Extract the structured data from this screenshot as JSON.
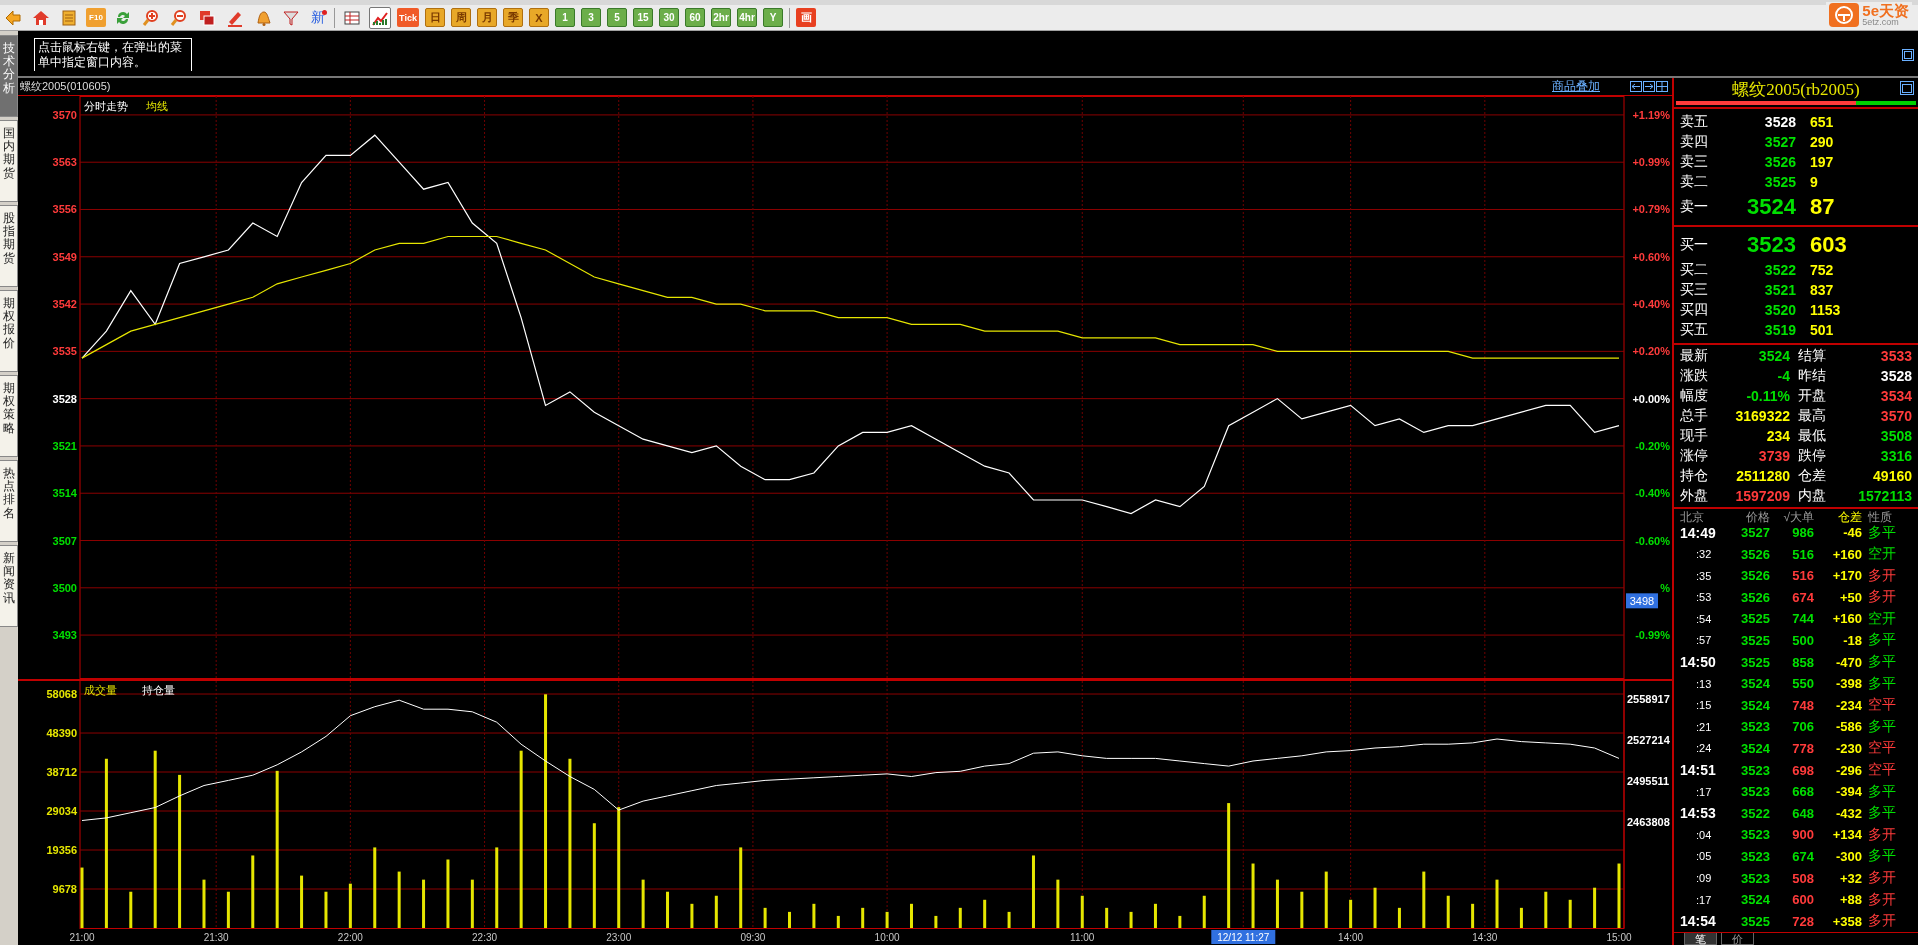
{
  "toolbar": {
    "groups": [
      [
        {
          "kind": "back",
          "selected": false
        },
        {
          "kind": "home",
          "selected": false
        },
        {
          "kind": "note",
          "selected": false
        },
        {
          "kind": "f10",
          "label": "F10",
          "selected": false
        },
        {
          "kind": "refresh",
          "selected": false
        },
        {
          "kind": "zoom_in",
          "selected": false
        },
        {
          "kind": "zoom_out",
          "selected": false
        },
        {
          "kind": "windows",
          "selected": false
        },
        {
          "kind": "pencil",
          "selected": false
        },
        {
          "kind": "bell",
          "selected": false
        },
        {
          "kind": "filter",
          "selected": false
        },
        {
          "kind": "new",
          "label": "新",
          "selected": false
        }
      ],
      [
        {
          "kind": "table",
          "selected": false
        },
        {
          "kind": "chart",
          "selected": true
        },
        {
          "kind": "tick",
          "label": "Tick",
          "selected": false
        },
        {
          "kind": "period",
          "label": "日",
          "selected": false
        },
        {
          "kind": "period",
          "label": "周",
          "selected": false
        },
        {
          "kind": "period",
          "label": "月",
          "selected": false
        },
        {
          "kind": "period",
          "label": "季",
          "selected": false
        },
        {
          "kind": "period",
          "label": "X",
          "selected": false
        },
        {
          "kind": "minute",
          "label": "1",
          "selected": false
        },
        {
          "kind": "minute",
          "label": "3",
          "selected": false
        },
        {
          "kind": "minute",
          "label": "5",
          "selected": false
        },
        {
          "kind": "minute",
          "label": "15",
          "selected": false
        },
        {
          "kind": "minute",
          "label": "30",
          "selected": false
        },
        {
          "kind": "minute",
          "label": "60",
          "selected": false
        },
        {
          "kind": "minute",
          "label": "2hr",
          "selected": false
        },
        {
          "kind": "minute",
          "label": "4hr",
          "selected": false
        },
        {
          "kind": "minute",
          "label": "Y",
          "selected": false
        }
      ],
      [
        {
          "kind": "draw",
          "label": "画",
          "selected": false
        }
      ]
    ]
  },
  "logo": {
    "name": "5e天资",
    "domain": "5etz.com"
  },
  "side_tabs": [
    {
      "label": "技术分析",
      "selected": true
    },
    {
      "label": "国内期货",
      "selected": false
    },
    {
      "label": "股指期货",
      "selected": false
    },
    {
      "label": "期权报价",
      "selected": false
    },
    {
      "label": "期权策略",
      "selected": false
    },
    {
      "label": "热点排名",
      "selected": false
    },
    {
      "label": "新闻资讯",
      "selected": false
    }
  ],
  "hint": "点击鼠标右键，在弹出的菜单中指定窗口内容。",
  "chart_header": {
    "title": "螺纹2005(010605)",
    "overlay_link": "商品叠加"
  },
  "price_chart": {
    "chart_data": {
      "type": "line",
      "grid": true,
      "series": [
        {
          "name": "分时走势",
          "color": "#ffffff",
          "values": [
            3534,
            3538,
            3544,
            3539,
            3548,
            3549,
            3550,
            3554,
            3552,
            3560,
            3564,
            3564,
            3567,
            3563,
            3559,
            3560,
            3554,
            3551,
            3540,
            3527,
            3529,
            3526,
            3524,
            3522,
            3521,
            3520,
            3521,
            3518,
            3516,
            3516,
            3517,
            3521,
            3523,
            3523,
            3524,
            3522,
            3520,
            3518,
            3517,
            3513,
            3513,
            3513,
            3512,
            3511,
            3513,
            3512,
            3515,
            3524,
            3526,
            3528,
            3525,
            3526,
            3527,
            3524,
            3525,
            3523,
            3524,
            3524,
            3525,
            3526,
            3527,
            3527,
            3523,
            3524
          ]
        },
        {
          "name": "均线",
          "color": "#e6e600",
          "values": [
            3534,
            3536,
            3538,
            3539,
            3540,
            3541,
            3542,
            3543,
            3545,
            3546,
            3547,
            3548,
            3550,
            3551,
            3551,
            3552,
            3552,
            3552,
            3551,
            3550,
            3548,
            3546,
            3545,
            3544,
            3543,
            3543,
            3542,
            3542,
            3541,
            3541,
            3541,
            3540,
            3540,
            3540,
            3539,
            3539,
            3539,
            3538,
            3538,
            3538,
            3538,
            3537,
            3537,
            3537,
            3537,
            3536,
            3536,
            3536,
            3536,
            3535,
            3535,
            3535,
            3535,
            3535,
            3535,
            3535,
            3535,
            3534,
            3534,
            3534,
            3534,
            3534,
            3534,
            3534
          ]
        }
      ],
      "ylim": [
        3486.5,
        3572.8
      ],
      "yticks": [
        3570,
        3563,
        3556,
        3549,
        3542,
        3535,
        3528,
        3521,
        3514,
        3507,
        3500,
        3493
      ]
    },
    "percent_labels": [
      {
        "label": "+1.19%",
        "color": "#ff3b3b"
      },
      {
        "label": "+0.99%",
        "color": "#ff3b3b"
      },
      {
        "label": "+0.79%",
        "color": "#ff3b3b"
      },
      {
        "label": "+0.60%",
        "color": "#ff3b3b"
      },
      {
        "label": "+0.40%",
        "color": "#ff3b3b"
      },
      {
        "label": "+0.20%",
        "color": "#ff3b3b"
      },
      {
        "label": "+0.00%",
        "color": "#ffffff"
      },
      {
        "label": "-0.20%",
        "color": "#00e000"
      },
      {
        "label": "-0.40%",
        "color": "#00e000"
      },
      {
        "label": "-0.60%",
        "color": "#00e000"
      },
      {
        "label": "%",
        "color": "#00e000"
      },
      {
        "label": "-0.99%",
        "color": "#00e000"
      }
    ],
    "cursor_price": "3498"
  },
  "volume_chart": {
    "chart_data": {
      "type": "bar",
      "grid": true,
      "series": [
        {
          "name": "成交量",
          "color": "#e6e600",
          "values": [
            15000,
            42000,
            9000,
            44000,
            38000,
            12000,
            9000,
            18000,
            39000,
            13000,
            9000,
            11000,
            20000,
            14000,
            12000,
            17000,
            12000,
            20000,
            44000,
            58000,
            42000,
            26000,
            30000,
            12000,
            9000,
            6000,
            8000,
            20000,
            5000,
            4000,
            6000,
            3000,
            5000,
            4000,
            6000,
            3000,
            5000,
            7000,
            4000,
            18000,
            12000,
            8000,
            5000,
            4000,
            6000,
            3000,
            8000,
            31000,
            16000,
            12000,
            9000,
            14000,
            7000,
            10000,
            5000,
            14000,
            8000,
            6000,
            12000,
            5000,
            9000,
            7000,
            10000,
            16000
          ]
        }
      ],
      "ylim": [
        0,
        61300
      ],
      "yticks": [
        58068,
        48390,
        38712,
        29034,
        19356,
        9678
      ]
    }
  },
  "open_interest_chart": {
    "chart_data": {
      "type": "line",
      "series": [
        {
          "name": "持仓量",
          "color": "#ffffff",
          "values": [
            2465000,
            2467000,
            2471000,
            2475000,
            2484000,
            2492000,
            2496000,
            2500000,
            2508000,
            2518000,
            2530000,
            2546000,
            2553000,
            2558000,
            2551000,
            2551000,
            2549000,
            2541000,
            2524000,
            2511000,
            2499000,
            2489000,
            2473000,
            2480000,
            2484000,
            2488000,
            2492000,
            2494000,
            2496000,
            2497000,
            2498000,
            2499000,
            2500000,
            2501000,
            2499000,
            2502000,
            2503000,
            2507000,
            2509000,
            2517000,
            2518000,
            2515000,
            2513000,
            2513000,
            2513000,
            2511000,
            2509000,
            2507000,
            2511000,
            2513000,
            2515000,
            2518000,
            2519000,
            2521000,
            2522000,
            2524000,
            2524000,
            2525000,
            2528000,
            2526000,
            2525000,
            2524000,
            2521000,
            2513000
          ]
        }
      ],
      "ylim": [
        2381845,
        2572835
      ],
      "yticks": [
        2558917,
        2527214,
        2495511,
        2463808
      ]
    }
  },
  "time_axis": {
    "labels": [
      "21:00",
      "21:30",
      "22:00",
      "22:30",
      "23:00",
      "09:30",
      "10:00",
      "11:00",
      "14:00",
      "14:30",
      "15:00"
    ],
    "cursor_time": "12/12 11:27"
  },
  "quote": {
    "title": "螺纹2005(rb2005)",
    "level": 0.75,
    "sells": [
      {
        "label": "卖五",
        "price": "3528",
        "volume": "651"
      },
      {
        "label": "卖四",
        "price": "3527",
        "volume": "290"
      },
      {
        "label": "卖三",
        "price": "3526",
        "volume": "197"
      },
      {
        "label": "卖二",
        "price": "3525",
        "volume": "9"
      },
      {
        "label": "卖一",
        "price": "3524",
        "volume": "87"
      }
    ],
    "buys": [
      {
        "label": "买一",
        "price": "3523",
        "volume": "603"
      },
      {
        "label": "买二",
        "price": "3522",
        "volume": "752"
      },
      {
        "label": "买三",
        "price": "3521",
        "volume": "837"
      },
      {
        "label": "买四",
        "price": "3520",
        "volume": "1153"
      },
      {
        "label": "买五",
        "price": "3519",
        "volume": "501"
      }
    ],
    "stats": [
      {
        "label": "最新",
        "value": "3524",
        "color": "#00e000"
      },
      {
        "label": "结算",
        "value": "3533",
        "color": "#ff3b3b"
      },
      {
        "label": "涨跌",
        "value": "-4",
        "color": "#00e000"
      },
      {
        "label": "昨结",
        "value": "3528",
        "color": "#ffffff"
      },
      {
        "label": "幅度",
        "value": "-0.11%",
        "color": "#00e000"
      },
      {
        "label": "开盘",
        "value": "3534",
        "color": "#ff3b3b"
      },
      {
        "label": "总手",
        "value": "3169322",
        "color": "#ffff00"
      },
      {
        "label": "最高",
        "value": "3570",
        "color": "#ff3b3b"
      },
      {
        "label": "现手",
        "value": "234",
        "color": "#ffff00"
      },
      {
        "label": "最低",
        "value": "3508",
        "color": "#00e000"
      },
      {
        "label": "涨停",
        "value": "3739",
        "color": "#ff3b3b"
      },
      {
        "label": "跌停",
        "value": "3316",
        "color": "#00e000"
      },
      {
        "label": "持仓",
        "value": "2511280",
        "color": "#ffff00"
      },
      {
        "label": "仓差",
        "value": "49160",
        "color": "#ffff00"
      },
      {
        "label": "外盘",
        "value": "1597209",
        "color": "#ff3b3b"
      },
      {
        "label": "内盘",
        "value": "1572113",
        "color": "#00e000"
      }
    ]
  },
  "ticks": {
    "columns": [
      "北京",
      "价格",
      "√大单",
      "仓差",
      "性质"
    ],
    "rows": [
      {
        "kind": "minute",
        "time": "14:49",
        "price": "3527",
        "volume": "986",
        "oi_change": "-46",
        "nature": "多平",
        "color": "#00e000"
      },
      {
        "kind": "second",
        "time": ":32",
        "price": "3526",
        "volume": "516",
        "oi_change": "+160",
        "nature": "空开",
        "color": "#00e000"
      },
      {
        "kind": "second",
        "time": ":35",
        "price": "3526",
        "volume": "516",
        "oi_change": "+170",
        "nature": "多开",
        "color": "#ff3b3b"
      },
      {
        "kind": "second",
        "time": ":53",
        "price": "3526",
        "volume": "674",
        "oi_change": "+50",
        "nature": "多开",
        "color": "#ff3b3b"
      },
      {
        "kind": "second",
        "time": ":54",
        "price": "3525",
        "volume": "744",
        "oi_change": "+160",
        "nature": "空开",
        "color": "#00e000"
      },
      {
        "kind": "second",
        "time": ":57",
        "price": "3525",
        "volume": "500",
        "oi_change": "-18",
        "nature": "多平",
        "color": "#00e000"
      },
      {
        "kind": "minute",
        "time": "14:50",
        "price": "3525",
        "volume": "858",
        "oi_change": "-470",
        "nature": "多平",
        "color": "#00e000"
      },
      {
        "kind": "second",
        "time": ":13",
        "price": "3524",
        "volume": "550",
        "oi_change": "-398",
        "nature": "多平",
        "color": "#00e000"
      },
      {
        "kind": "second",
        "time": ":15",
        "price": "3524",
        "volume": "748",
        "oi_change": "-234",
        "nature": "空平",
        "color": "#ff3b3b"
      },
      {
        "kind": "second",
        "time": ":21",
        "price": "3523",
        "volume": "706",
        "oi_change": "-586",
        "nature": "多平",
        "color": "#00e000"
      },
      {
        "kind": "second",
        "time": ":24",
        "price": "3524",
        "volume": "778",
        "oi_change": "-230",
        "nature": "空平",
        "color": "#ff3b3b"
      },
      {
        "kind": "minute",
        "time": "14:51",
        "price": "3523",
        "volume": "698",
        "oi_change": "-296",
        "nature": "空平",
        "color": "#ff3b3b"
      },
      {
        "kind": "second",
        "time": ":17",
        "price": "3523",
        "volume": "668",
        "oi_change": "-394",
        "nature": "多平",
        "color": "#00e000"
      },
      {
        "kind": "minute",
        "time": "14:53",
        "price": "3522",
        "volume": "648",
        "oi_change": "-432",
        "nature": "多平",
        "color": "#00e000"
      },
      {
        "kind": "second",
        "time": ":04",
        "price": "3523",
        "volume": "900",
        "oi_change": "+134",
        "nature": "多开",
        "color": "#ff3b3b"
      },
      {
        "kind": "second",
        "time": ":05",
        "price": "3523",
        "volume": "674",
        "oi_change": "-300",
        "nature": "多平",
        "color": "#00e000"
      },
      {
        "kind": "second",
        "time": ":09",
        "price": "3523",
        "volume": "508",
        "oi_change": "+32",
        "nature": "多开",
        "color": "#ff3b3b"
      },
      {
        "kind": "second",
        "time": ":17",
        "price": "3524",
        "volume": "600",
        "oi_change": "+88",
        "nature": "多开",
        "color": "#ff3b3b"
      },
      {
        "kind": "minute",
        "time": "14:54",
        "price": "3525",
        "volume": "728",
        "oi_change": "+358",
        "nature": "多开",
        "color": "#ff3b3b"
      }
    ]
  },
  "bottom_tabs": [
    {
      "label": "笔",
      "selected": true
    },
    {
      "label": "价",
      "selected": false
    }
  ]
}
